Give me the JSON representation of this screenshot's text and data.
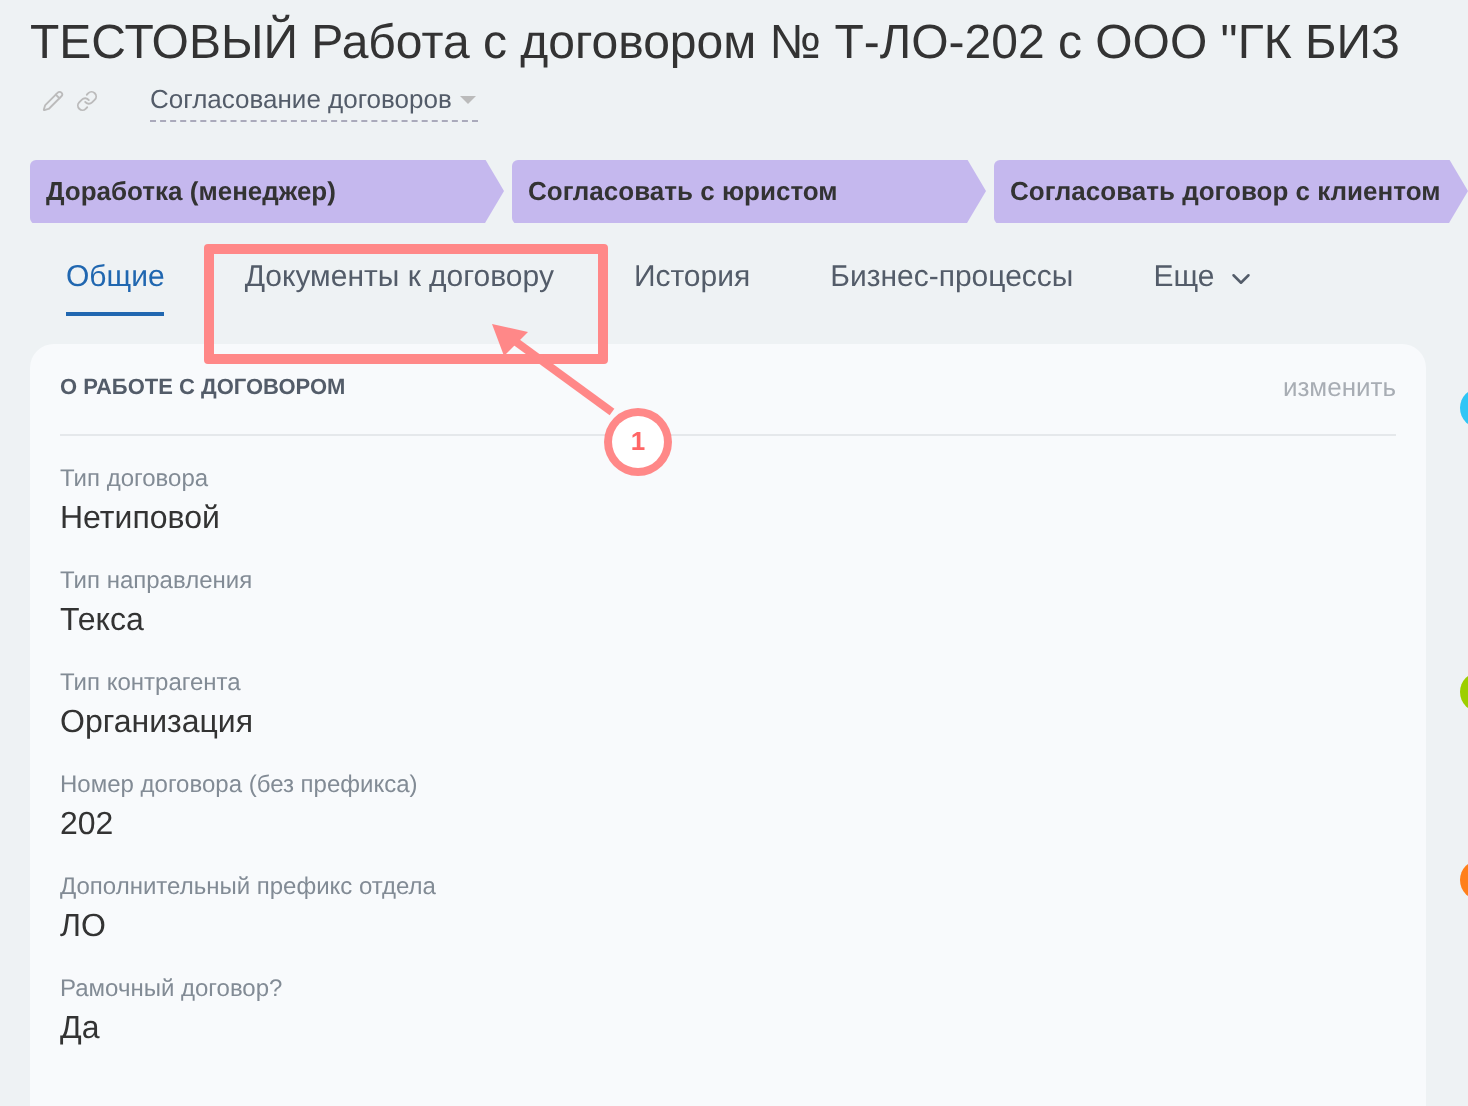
{
  "title": "ТЕСТОВЫЙ Работа с договором № Т-ЛО-202 с ООО \"ГК БИЗ",
  "category": "Согласование договоров",
  "stages": [
    {
      "label": "Доработка (менеджер)"
    },
    {
      "label": "Согласовать с юристом"
    },
    {
      "label": "Согласовать договор с клиентом"
    }
  ],
  "tabs": [
    {
      "label": "Общие",
      "selected": true
    },
    {
      "label": "Документы к договору",
      "selected": false
    },
    {
      "label": "История",
      "selected": false
    },
    {
      "label": "Бизнес-процессы",
      "selected": false
    },
    {
      "label": "Еще",
      "selected": false,
      "kind": "more"
    }
  ],
  "annotation": {
    "number": "1"
  },
  "card": {
    "title": "О РАБОТЕ С ДОГОВОРОМ",
    "action": "изменить",
    "fields": [
      {
        "label": "Тип договора",
        "value": "Нетиповой"
      },
      {
        "label": "Тип направления",
        "value": "Текса"
      },
      {
        "label": "Тип контрагента",
        "value": "Организация"
      },
      {
        "label": "Номер договора (без префикса)",
        "value": "202"
      },
      {
        "label": "Дополнительный префикс отдела",
        "value": "ЛО"
      },
      {
        "label": "Рамочный договор?",
        "value": "Да"
      }
    ]
  },
  "timeline_dots": [
    {
      "color": "#2fc6f6"
    },
    {
      "color": "#9dcf00"
    },
    {
      "color": "#ff7f1a"
    }
  ]
}
